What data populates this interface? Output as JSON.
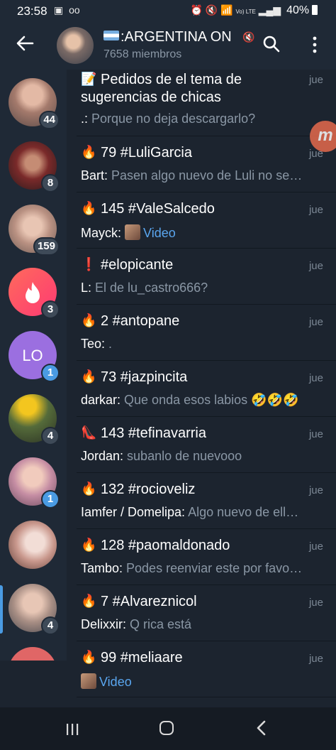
{
  "status_bar": {
    "time": "23:58",
    "left_icons": [
      "image-icon",
      "voicemail-icon"
    ],
    "right_icons": [
      "alarm-icon",
      "mute-icon",
      "wifi-icon",
      "lte-icon",
      "signal-icon"
    ],
    "lte_text": "Vo) LTE",
    "battery": "40%"
  },
  "header": {
    "title": ":ARGENTINA ON",
    "subtitle": "7658 miembros"
  },
  "sidebar": {
    "items": [
      {
        "badge": "44",
        "badge_color": "gray"
      },
      {
        "badge": "8",
        "badge_color": "gray"
      },
      {
        "badge": "159",
        "badge_color": "gray"
      },
      {
        "badge": "3",
        "badge_color": "gray",
        "avatar_icon": "tinder-flame-icon"
      },
      {
        "initials": "LO",
        "badge": "1",
        "badge_color": "blue"
      },
      {
        "badge": "4",
        "badge_color": "gray"
      },
      {
        "badge": "1",
        "badge_color": "blue"
      },
      {
        "badge": "",
        "badge_color": "none"
      },
      {
        "badge": "4",
        "badge_color": "gray",
        "active": true
      }
    ]
  },
  "topics": [
    {
      "emoji": "📝",
      "title_line1": "Pedidos de el tema de",
      "title_line2": "sugerencias de chicas",
      "date": "jue",
      "author": ".: ",
      "text": "Porque no deja descargarlo?"
    },
    {
      "emoji": "🔥",
      "title": "79 #LuliGarcia",
      "date": "jue",
      "author": "Bart: ",
      "text": "Pasen algo nuevo de Luli no se…"
    },
    {
      "emoji": "🔥",
      "title": "145 #ValeSalcedo",
      "date": "jue",
      "author": "Mayck: ",
      "media": "Video"
    },
    {
      "emoji": "❗",
      "title": "#elopicante",
      "date": "jue",
      "author": "L: ",
      "text": "El de lu_castro666?"
    },
    {
      "emoji": "🔥",
      "title": "2 #antopane",
      "date": "jue",
      "author": "Teo: ",
      "text": "."
    },
    {
      "emoji": "🔥",
      "title": "73 #jazpincita",
      "date": "jue",
      "author": "darkar: ",
      "text": "Que onda esos labios 🤣🤣🤣"
    },
    {
      "emoji": "👠",
      "title": "143 #tefinavarria",
      "date": "jue",
      "author": "Jordan: ",
      "text": "subanlo de nuevooo"
    },
    {
      "emoji": "🔥",
      "title": "132 #rocioveliz",
      "date": "jue",
      "author": "Iamfer / Domelipa: ",
      "text": "Algo nuevo de ell…"
    },
    {
      "emoji": "🔥",
      "title": "128 #paomaldonado",
      "date": "jue",
      "author": "Tambo: ",
      "text": "Podes reenviar este por favo…"
    },
    {
      "emoji": "🔥",
      "title": "7 #Alvareznicol",
      "date": "jue",
      "author": "Delixxir: ",
      "text": "Q rica está"
    },
    {
      "emoji": "🔥",
      "title": "99 #meliaare",
      "date": "jue",
      "author": "",
      "media": "Video"
    }
  ],
  "floating_logo": "m"
}
